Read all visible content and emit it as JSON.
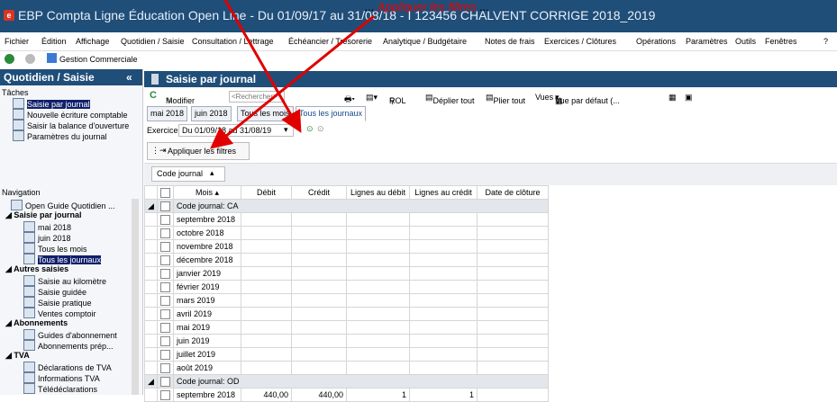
{
  "window": {
    "title": "EBP Compta Ligne Éducation Open Line - Du 01/09/17 au 31/08/18 - I 123456 CHALVENT CORRIGE 2018_2019"
  },
  "annotation": {
    "prefix": "...",
    "highlight": "Appliquer les filtres",
    "suffix": "..."
  },
  "menu": {
    "items": [
      "Fichier",
      "Édition",
      "Affichage",
      "Quotidien / Saisie",
      "Consultation / Lettrage",
      "Échéancier / Trésorerie",
      "Analytique / Budgétaire",
      "Notes de frais",
      "Exercices / Clôtures",
      "Opérations",
      "Paramètres",
      "Outils",
      "Fenêtres",
      "?"
    ]
  },
  "nav": {
    "gestion_label": "Gestion Commerciale"
  },
  "sidebar": {
    "title": "Quotidien / Saisie",
    "collapse_glyph": "«",
    "tasks_label": "Tâches",
    "tasks": [
      "Saisie par journal",
      "Nouvelle écriture comptable",
      "Saisir la balance d'ouverture",
      "Paramètres du journal"
    ],
    "navigation_label": "Navigation",
    "nav_items": {
      "open_guide": "Open Guide Quotidien ...",
      "saisie_par_journal": "Saisie par journal",
      "sp_items": [
        "mai 2018",
        "juin 2018",
        "Tous les mois",
        "Tous les journaux"
      ],
      "autres_saisies": "Autres saisies",
      "as_items": [
        "Saisie au kilomètre",
        "Saisie guidée",
        "Saisie pratique",
        "Ventes comptoir"
      ],
      "abonnements": "Abonnements",
      "ab_items": [
        "Guides d'abonnement",
        "Abonnements prép..."
      ],
      "tva": "TVA",
      "tva_items": [
        "Déclarations de TVA",
        "Informations TVA",
        "Télédéclarations"
      ]
    }
  },
  "main": {
    "title": "Saisie par journal",
    "toolbar": {
      "modifier": "Modifier",
      "search_placeholder": "<Rechercher>",
      "rol": "ROL",
      "deplier": "Déplier tout",
      "plier": "Plier tout",
      "vues": "Vues",
      "vue_defaut": "Vue par défaut (..."
    },
    "tabs": [
      "mai 2018",
      "juin 2018",
      "Tous les mois",
      "Tous les journaux"
    ],
    "exercice_label": "Exercice",
    "exercice_value": "Du 01/09/18 au 31/08/19",
    "filter_button": "Appliquer les filtres",
    "group_by": "Code journal"
  },
  "grid": {
    "columns": [
      "Mois",
      "Débit",
      "Crédit",
      "Lignes au débit",
      "Lignes au crédit",
      "Date de clôture"
    ],
    "groups": [
      {
        "label": "Code journal: CA",
        "rows": [
          [
            "septembre 2018",
            "",
            "",
            "",
            "",
            ""
          ],
          [
            "octobre 2018",
            "",
            "",
            "",
            "",
            ""
          ],
          [
            "novembre 2018",
            "",
            "",
            "",
            "",
            ""
          ],
          [
            "décembre 2018",
            "",
            "",
            "",
            "",
            ""
          ],
          [
            "janvier 2019",
            "",
            "",
            "",
            "",
            ""
          ],
          [
            "février 2019",
            "",
            "",
            "",
            "",
            ""
          ],
          [
            "mars 2019",
            "",
            "",
            "",
            "",
            ""
          ],
          [
            "avril 2019",
            "",
            "",
            "",
            "",
            ""
          ],
          [
            "mai 2019",
            "",
            "",
            "",
            "",
            ""
          ],
          [
            "juin 2019",
            "",
            "",
            "",
            "",
            ""
          ],
          [
            "juillet 2019",
            "",
            "",
            "",
            "",
            ""
          ],
          [
            "août 2019",
            "",
            "",
            "",
            "",
            ""
          ]
        ]
      },
      {
        "label": "Code journal: OD",
        "rows": [
          [
            "septembre 2018",
            "440,00",
            "440,00",
            "1",
            "1",
            ""
          ]
        ]
      }
    ]
  },
  "colors": {
    "titlebar": "#1f4e79",
    "selected": "#10206b",
    "arrow": "#e00000"
  }
}
